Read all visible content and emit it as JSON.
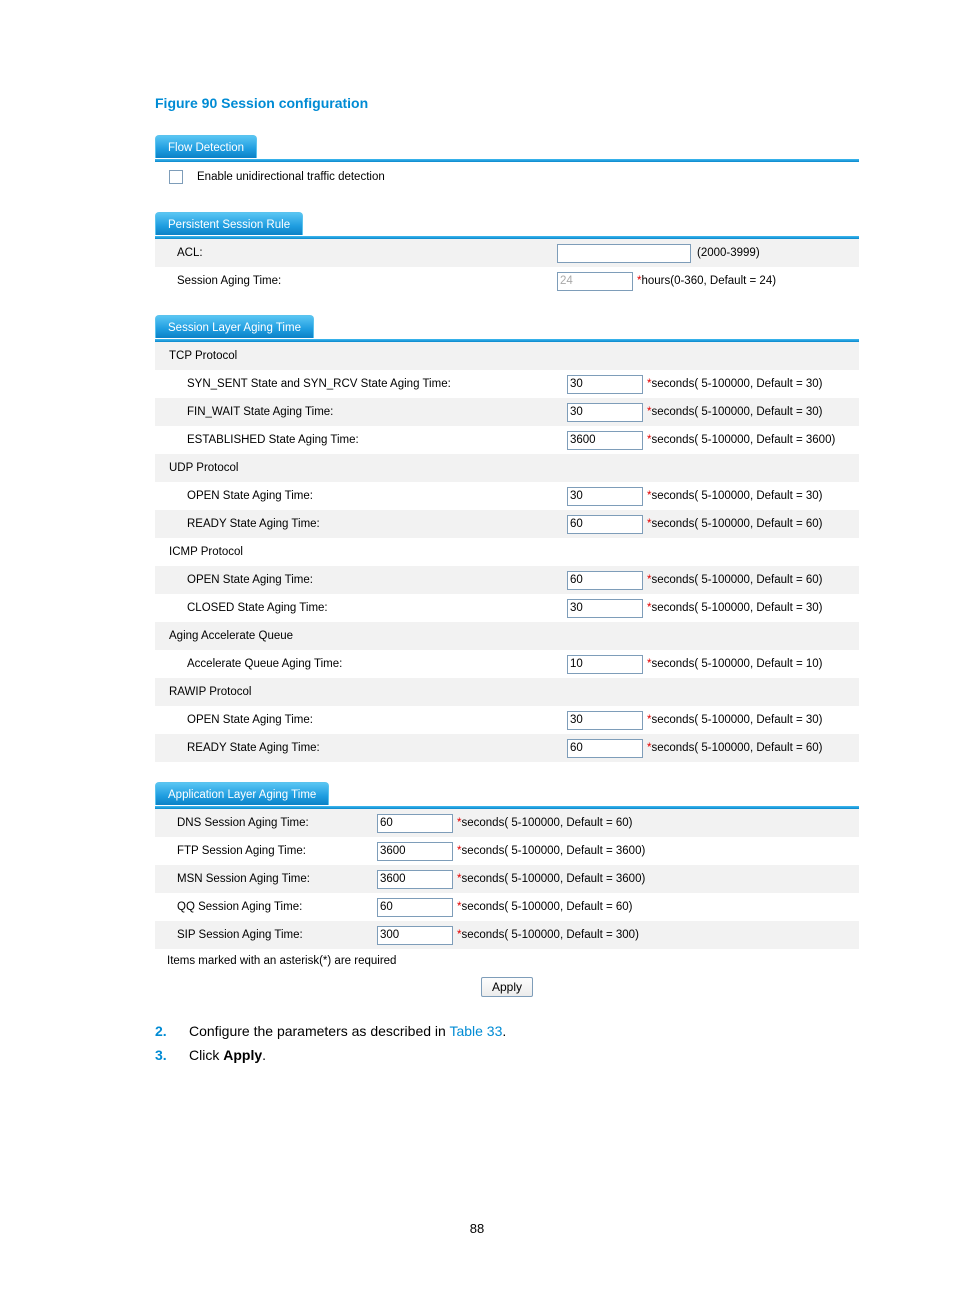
{
  "title": "Figure 90 Session configuration",
  "flowDetection": {
    "tab": "Flow Detection",
    "checkboxLabel": "Enable unidirectional traffic detection"
  },
  "persistent": {
    "tab": "Persistent Session Rule",
    "aclLabel": "ACL:",
    "aclValue": "",
    "aclHint": "(2000-3999)",
    "agingLabel": "Session Aging Time:",
    "agingValue": "24",
    "agingHint": "hours(0-360, Default = 24)"
  },
  "sessionLayer": {
    "tab": "Session Layer Aging Time",
    "groups": {
      "tcp": "TCP Protocol",
      "udp": "UDP Protocol",
      "icmp": "ICMP Protocol",
      "accel": "Aging Accelerate Queue",
      "rawip": "RAWIP Protocol"
    },
    "rows": {
      "syn": {
        "label": "SYN_SENT State and SYN_RCV State Aging Time:",
        "value": "30",
        "hint": "seconds( 5-100000, Default = 30)"
      },
      "fin": {
        "label": "FIN_WAIT State Aging Time:",
        "value": "30",
        "hint": "seconds( 5-100000, Default = 30)"
      },
      "est": {
        "label": "ESTABLISHED State Aging Time:",
        "value": "3600",
        "hint": "seconds( 5-100000, Default = 3600)"
      },
      "udpOpen": {
        "label": "OPEN State Aging Time:",
        "value": "30",
        "hint": "seconds( 5-100000, Default = 30)"
      },
      "udpReady": {
        "label": "READY State Aging Time:",
        "value": "60",
        "hint": "seconds( 5-100000, Default = 60)"
      },
      "icmpOpen": {
        "label": "OPEN State Aging Time:",
        "value": "60",
        "hint": "seconds( 5-100000, Default = 60)"
      },
      "icmpClosed": {
        "label": "CLOSED State Aging Time:",
        "value": "30",
        "hint": "seconds( 5-100000, Default = 30)"
      },
      "accelQueue": {
        "label": "Accelerate Queue Aging Time:",
        "value": "10",
        "hint": "seconds( 5-100000, Default = 10)"
      },
      "rawipOpen": {
        "label": "OPEN State Aging Time:",
        "value": "30",
        "hint": "seconds( 5-100000, Default = 30)"
      },
      "rawipReady": {
        "label": "READY State Aging Time:",
        "value": "60",
        "hint": "seconds( 5-100000, Default = 60)"
      }
    }
  },
  "appLayer": {
    "tab": "Application Layer Aging Time",
    "rows": {
      "dns": {
        "label": "DNS Session Aging Time:",
        "value": "60",
        "hint": "seconds( 5-100000, Default = 60)"
      },
      "ftp": {
        "label": "FTP Session Aging Time:",
        "value": "3600",
        "hint": "seconds( 5-100000, Default = 3600)"
      },
      "msn": {
        "label": "MSN Session Aging Time:",
        "value": "3600",
        "hint": "seconds( 5-100000, Default = 3600)"
      },
      "qq": {
        "label": "QQ Session Aging Time:",
        "value": "60",
        "hint": "seconds( 5-100000, Default = 60)"
      },
      "sip": {
        "label": "SIP Session Aging Time:",
        "value": "300",
        "hint": "seconds( 5-100000, Default = 300)"
      }
    }
  },
  "note": "Items marked with an asterisk(*) are required",
  "apply": "Apply",
  "steps": {
    "s2num": "2.",
    "s2a": "Configure the parameters as described in ",
    "s2link": "Table 33",
    "s2b": ".",
    "s3num": "3.",
    "s3a": "Click ",
    "s3bold": "Apply",
    "s3b": "."
  },
  "pageNumber": "88"
}
